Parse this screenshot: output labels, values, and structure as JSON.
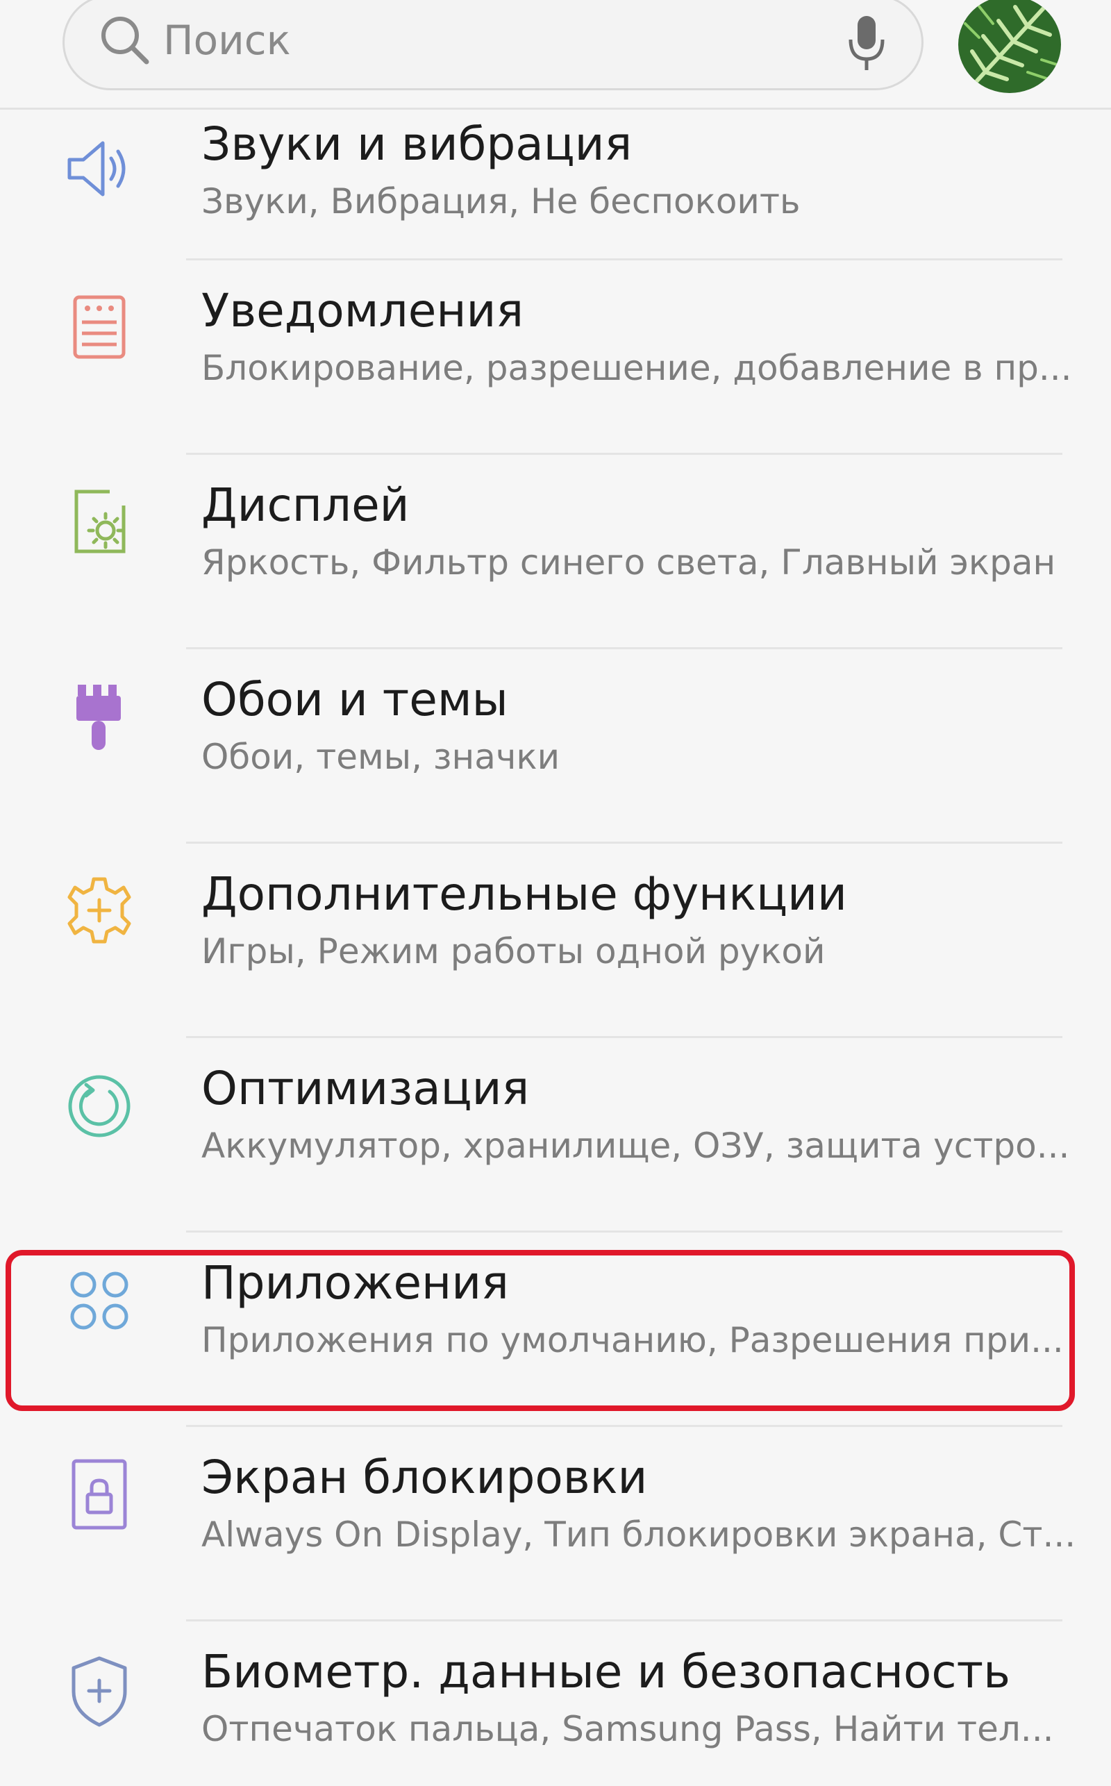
{
  "search": {
    "placeholder": "Поиск"
  },
  "settings": {
    "items": [
      {
        "title": "Звуки и вибрация",
        "subtitle": "Звуки, Вибрация, Не беспокоить",
        "icon": "speaker-icon",
        "color": "#6f8fd8"
      },
      {
        "title": "Уведомления",
        "subtitle": "Блокирование, разрешение, добавление в пр...",
        "icon": "notifications-icon",
        "color": "#e98b80"
      },
      {
        "title": "Дисплей",
        "subtitle": "Яркость, Фильтр синего света, Главный экран",
        "icon": "display-brightness-icon",
        "color": "#8fb85a"
      },
      {
        "title": "Обои и темы",
        "subtitle": "Обои, темы, значки",
        "icon": "paint-brush-icon",
        "color": "#a873cf"
      },
      {
        "title": "Дополнительные функции",
        "subtitle": "Игры, Режим работы одной рукой",
        "icon": "gear-plus-icon",
        "color": "#f0b441"
      },
      {
        "title": "Оптимизация",
        "subtitle": "Аккумулятор, хранилище, ОЗУ, защита устро...",
        "icon": "optimization-icon",
        "color": "#5bc1a6"
      },
      {
        "title": "Приложения",
        "subtitle": "Приложения по умолчанию, Разрешения при...",
        "icon": "apps-grid-icon",
        "color": "#6fa8d9"
      },
      {
        "title": "Экран блокировки",
        "subtitle": "Always On Display, Тип блокировки экрана, Ст...",
        "icon": "lock-screen-icon",
        "color": "#9b84d6"
      },
      {
        "title": "Биометр. данные и безопасность",
        "subtitle": "Отпечаток пальца, Samsung Pass, Найти тел...",
        "icon": "shield-plus-icon",
        "color": "#7e90c0"
      }
    ]
  },
  "highlight_color": "#e0182a"
}
